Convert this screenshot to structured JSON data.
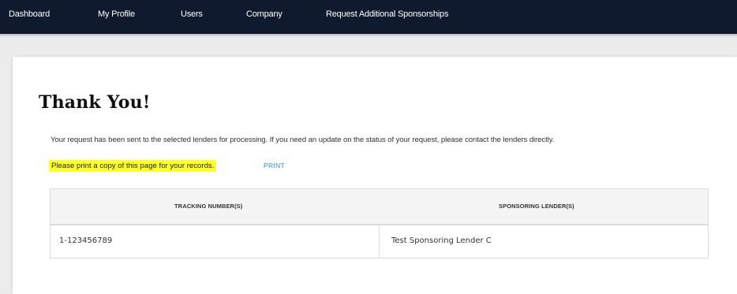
{
  "nav": {
    "items": [
      {
        "label": "Dashboard"
      },
      {
        "label": "My Profile"
      },
      {
        "label": "Users"
      },
      {
        "label": "Company"
      },
      {
        "label": "Request Additional Sponsorships"
      }
    ]
  },
  "main": {
    "heading": "Thank You!",
    "message": "Your request has been sent to the selected lenders for processing. If you need an update on the status of your request, please contact the lenders directly.",
    "print_note": "Please print a copy of this page for your records.",
    "print_link": "PRINT"
  },
  "table": {
    "headers": [
      "TRACKING NUMBER(S)",
      "SPONSORING LENDER(S)"
    ],
    "rows": [
      [
        "1-123456789",
        "Test Sponsoring Lender C"
      ]
    ]
  },
  "colors": {
    "nav_background": "#0f1a2e",
    "highlight": "#ffff2e",
    "link": "#2d8fd0"
  }
}
